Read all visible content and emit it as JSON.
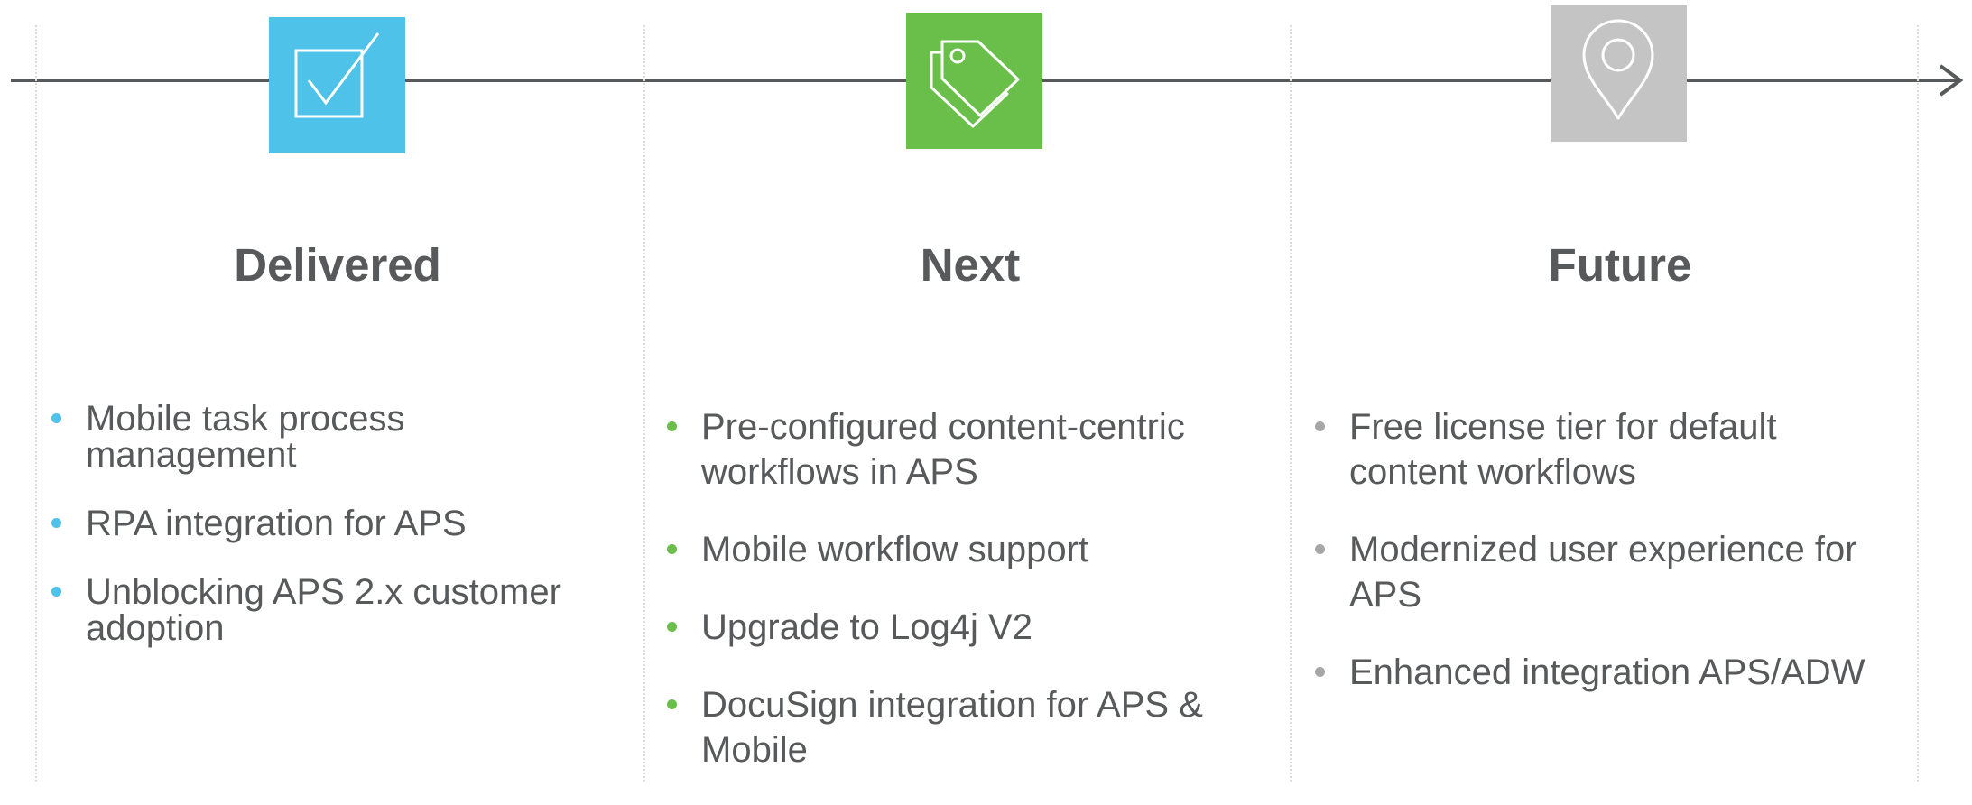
{
  "colors": {
    "delivered": "#4fc2e9",
    "next": "#6abf4b",
    "future": "#c4c4c4",
    "text": "#58595b",
    "line": "#58595b"
  },
  "icons": {
    "delivered": "checkbox-check-icon",
    "next": "price-tags-icon",
    "future": "map-pin-icon"
  },
  "columns": [
    {
      "title": "Delivered",
      "items": [
        "Mobile task process management",
        "RPA integration for APS",
        "Unblocking APS 2.x customer adoption"
      ]
    },
    {
      "title": "Next",
      "items": [
        "Pre-configured content-centric workflows in APS",
        "Mobile workflow support",
        "Upgrade to Log4j V2",
        "DocuSign integration for APS & Mobile"
      ]
    },
    {
      "title": "Future",
      "items": [
        "Free license tier for default content workflows",
        "Modernized user experience for APS",
        "Enhanced integration APS/ADW"
      ]
    }
  ]
}
